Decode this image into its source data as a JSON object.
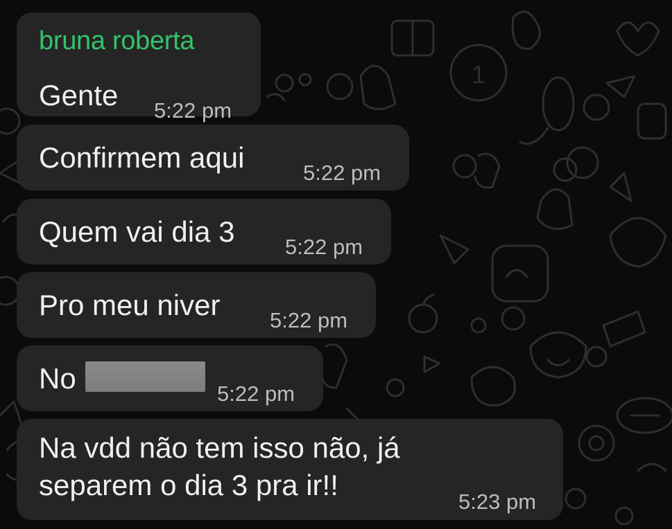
{
  "chat": {
    "sender_name": "bruna roberta",
    "messages": [
      {
        "text": "Gente",
        "time": "5:22 pm"
      },
      {
        "text": "Confirmem aqui",
        "time": "5:22 pm"
      },
      {
        "text": "Quem vai dia 3",
        "time": "5:22 pm"
      },
      {
        "text": "Pro meu niver",
        "time": "5:22 pm"
      },
      {
        "text": "No",
        "time": "5:22 pm"
      },
      {
        "text_line1": "Na vdd não tem isso não, já",
        "text_line2": "separem o dia 3 pra ir!!",
        "time": "5:23 pm"
      }
    ]
  },
  "colors": {
    "background": "#0b0b0b",
    "bubble": "#252525",
    "sender_name": "#35c26a",
    "timestamp": "#bdbdbd",
    "message_text": "#f0f0f0"
  }
}
